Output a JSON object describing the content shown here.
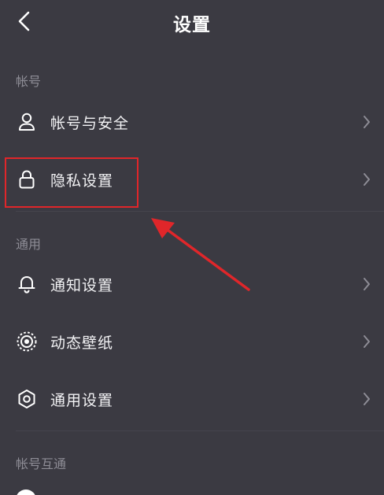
{
  "header": {
    "title": "设置",
    "back_icon": "chevron-left-icon"
  },
  "sections": [
    {
      "title": "帐号",
      "items": [
        {
          "label": "帐号与安全",
          "icon": "person-icon"
        },
        {
          "label": "隐私设置",
          "icon": "lock-icon"
        }
      ]
    },
    {
      "title": "通用",
      "items": [
        {
          "label": "通知设置",
          "icon": "bell-icon"
        },
        {
          "label": "动态壁纸",
          "icon": "wallpaper-icon"
        },
        {
          "label": "通用设置",
          "icon": "gear-icon"
        }
      ]
    },
    {
      "title": "帐号互通",
      "items": []
    }
  ],
  "colors": {
    "background": "#3b3a42",
    "section_title": "#8e8d96",
    "annotation": "#e0262a"
  }
}
